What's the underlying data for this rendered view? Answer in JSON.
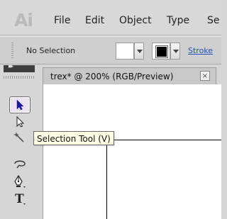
{
  "app": {
    "logo": "Ai"
  },
  "menu": {
    "items": [
      "File",
      "Edit",
      "Object",
      "Type",
      "Se"
    ]
  },
  "control_bar": {
    "selection_label": "No Selection",
    "stroke_link": "Stroke"
  },
  "document": {
    "tab_title": "trex* @ 200% (RGB/Preview)",
    "close_glyph": "×"
  },
  "tooltip": {
    "text": "Selection Tool (V)"
  },
  "panel": {
    "collapse_glyph": "▸▸"
  },
  "colors": {
    "active_tool_bg": "#ece4f2",
    "selection_arrow": "#1b1b9a",
    "stroke_link": "#2353b5",
    "tooltip_bg": "#ffffe6"
  },
  "icons": {
    "tools": [
      "selection-tool-icon",
      "direct-selection-tool-icon",
      "magic-wand-tool-icon",
      "lasso-tool-icon",
      "pen-tool-icon",
      "type-tool-icon"
    ]
  }
}
